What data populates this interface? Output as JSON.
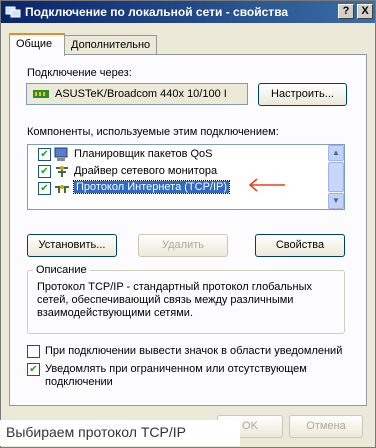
{
  "window": {
    "title": "Подключение по локальной сети - свойства",
    "help_btn": "?",
    "close_btn": "X"
  },
  "tabs": [
    {
      "label": "Общие",
      "active": true
    },
    {
      "label": "Дополнительно",
      "active": false
    }
  ],
  "general": {
    "connect_via_label": "Подключение через:",
    "adapter_name": "ASUSTeK/Broadcom 440x 10/100 I",
    "configure_button": "Настроить...",
    "components_label": "Компоненты, используемые этим подключением:",
    "components": [
      {
        "label": "Планировщик пакетов QoS",
        "checked": true,
        "icon": "qos-scheduler-icon"
      },
      {
        "label": "Драйвер сетевого монитора",
        "checked": true,
        "icon": "network-monitor-icon"
      },
      {
        "label": "Протокол Интернета (TCP/IP)",
        "checked": true,
        "icon": "protocol-icon",
        "selected": true
      }
    ],
    "install_button": "Установить...",
    "remove_button": "Удалить",
    "properties_button": "Свойства",
    "description_title": "Описание",
    "description_text": "Протокол TCP/IP - стандартный протокол глобальных сетей, обеспечивающий связь между различными взаимодействующими сетями.",
    "show_icon_checkbox": {
      "label": "При подключении вывести значок в области уведомлений",
      "checked": false
    },
    "notify_checkbox": {
      "label_line1": "Уведомлять при ограниченном или отсутствующем",
      "label_line2": "подключении",
      "checked": true
    }
  },
  "footer": {
    "ok_button": "OK",
    "cancel_button": "Отмена"
  },
  "caption": "Выбираем протокол TCP/IP",
  "colors": {
    "titlebar": "#0a246a",
    "selection": "#316ac5",
    "annotation_arrow": "#e8421b"
  }
}
